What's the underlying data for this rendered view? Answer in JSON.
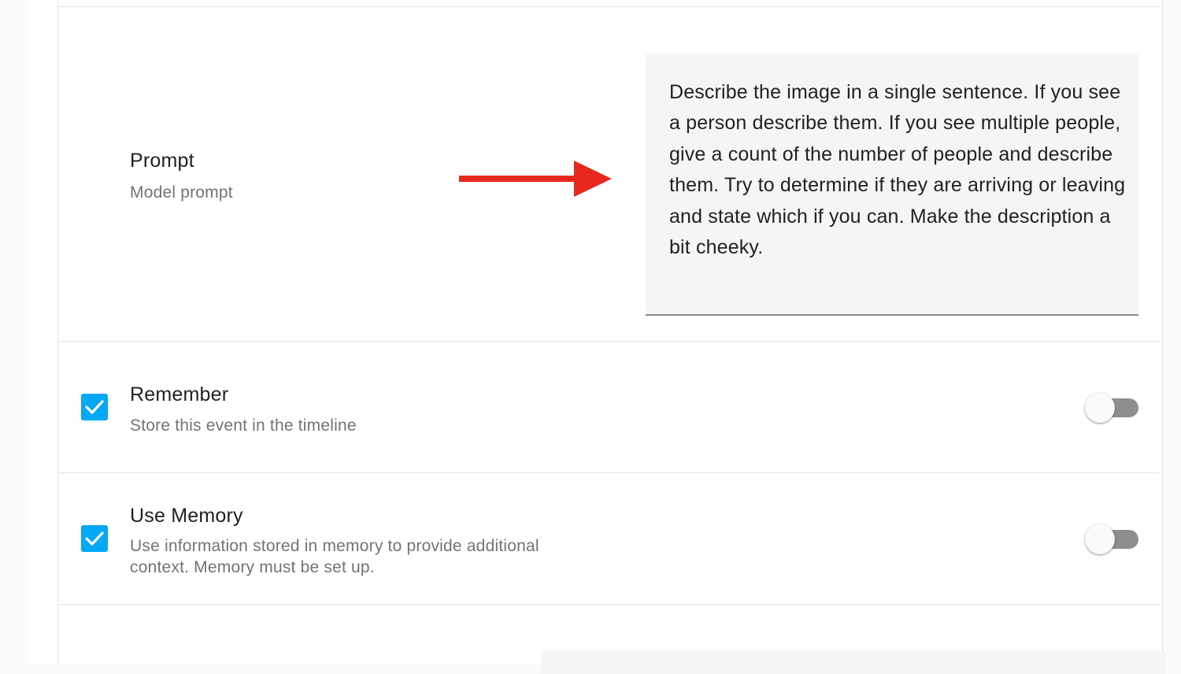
{
  "prompt_row": {
    "title": "Prompt",
    "description": "Model prompt",
    "value": "Describe the image in a single sentence. If you see a person describe them. If you see multiple people, give a count of the number of people and describe them. Try to determine if they are arriving or leaving and state which if you can. Make the description a bit cheeky."
  },
  "remember_row": {
    "title": "Remember",
    "description": "Store this event in the timeline",
    "checked": true,
    "toggle_on": false
  },
  "memory_row": {
    "title": "Use Memory",
    "description": "Use information stored in memory to provide additional context. Memory must be set up.",
    "checked": true,
    "toggle_on": false
  },
  "colors": {
    "accent": "#03a9f4",
    "arrow": "#e8281c",
    "toggle_off_track": "#8e8e8e"
  },
  "icons": {
    "annotation": "arrow-right-icon",
    "checkbox": "checkmark-icon"
  }
}
